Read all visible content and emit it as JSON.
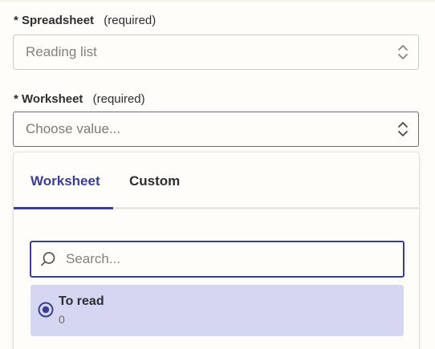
{
  "spreadsheet_field": {
    "asterisk": "*",
    "label": "Spreadsheet",
    "required_note": "(required)",
    "value": "Reading list",
    "icon": "chevron-up-down-icon"
  },
  "worksheet_field": {
    "asterisk": "*",
    "label": "Worksheet",
    "required_note": "(required)",
    "placeholder": "Choose value...",
    "icon": "chevron-up-down-icon"
  },
  "dropdown": {
    "tabs": [
      {
        "label": "Worksheet",
        "active": true
      },
      {
        "label": "Custom",
        "active": false
      }
    ],
    "search": {
      "placeholder": "Search...",
      "value": "",
      "icon": "search-icon"
    },
    "options": [
      {
        "title": "To read",
        "subtitle": "0",
        "selected": true
      }
    ]
  },
  "colors": {
    "accent": "#3b3e8c",
    "selected_bg": "#d4d6f2",
    "page_bg": "#fffdf9"
  }
}
